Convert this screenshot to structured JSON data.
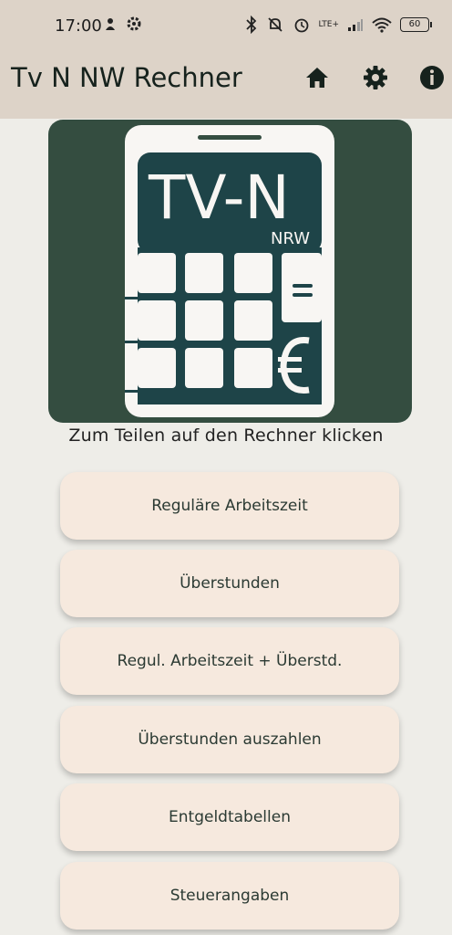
{
  "status": {
    "time": "17:00",
    "battery": "60",
    "network": "LTE+"
  },
  "app": {
    "title": "Tv N NW Rechner"
  },
  "logo": {
    "line1": "TV-N",
    "line2": "NRW"
  },
  "caption": "Zum Teilen auf den Rechner klicken",
  "menu": [
    {
      "label": "Reguläre Arbeitszeit"
    },
    {
      "label": "Überstunden"
    },
    {
      "label": "Regul. Arbeitszeit + Überstd."
    },
    {
      "label": "Überstunden auszahlen"
    },
    {
      "label": "Entgeldtabellen"
    },
    {
      "label": "Steuerangaben"
    }
  ],
  "icons": {
    "home": "home-icon",
    "settings": "gear-icon",
    "info": "info-icon"
  },
  "colors": {
    "topbar": "#ddd3c8",
    "logo_bg": "#344d40",
    "button_bg": "#f6e9de",
    "background": "#eeede8"
  }
}
